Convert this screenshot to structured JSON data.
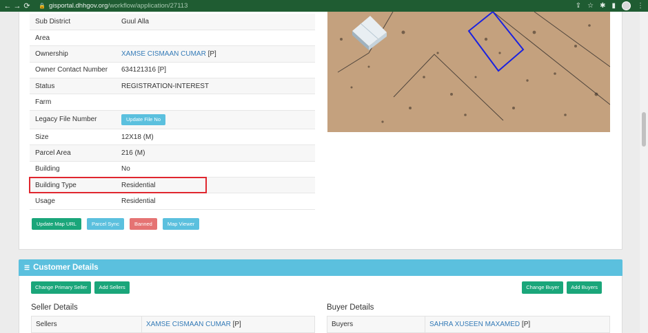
{
  "browser": {
    "url_host": "gisportal.dhhgov.org",
    "url_path": "/workflow/application/27113"
  },
  "parcel_info": {
    "rows": [
      {
        "label": "Sub District",
        "value": "Guul Alla"
      },
      {
        "label": "Area",
        "value": ""
      },
      {
        "label": "Ownership",
        "value": "XAMSE CISMAAN CUMAR",
        "value_suffix": " [P]"
      },
      {
        "label": "Owner Contact Number",
        "value": "634121316 [P]"
      },
      {
        "label": "Status",
        "value": "REGISTRATION-INTEREST"
      },
      {
        "label": "Farm",
        "value": ""
      },
      {
        "label": "Legacy File Number",
        "button": "Update File No"
      },
      {
        "label": "Size",
        "value": "12X18 (M)"
      },
      {
        "label": "Parcel Area",
        "value": "216 (M)"
      },
      {
        "label": "Building",
        "value": "No"
      },
      {
        "label": "Building Type",
        "value": "Residential"
      },
      {
        "label": "Usage",
        "value": "Residential"
      }
    ]
  },
  "actions": {
    "update_map_url": "Update Map URL",
    "parcel_sync": "Parcel Sync",
    "banned": "Banned",
    "map_viewer": "Map Viewer"
  },
  "customer": {
    "header": "Customer Details",
    "change_primary_seller": "Change Primary Seller",
    "add_sellers": "Add Sellers",
    "change_buyer": "Change Buyer",
    "add_buyers": "Add Buyers",
    "seller_title": "Seller Details",
    "buyer_title": "Buyer Details",
    "sellers_label": "Sellers",
    "seller_name": "XAMSE CISMAAN CUMAR",
    "seller_suffix": " [P]",
    "buyers_label": "Buyers",
    "buyer_name": "SAHRA XUSEEN MAXAMED",
    "buyer_suffix": " [P]"
  },
  "colors": {
    "chrome": "#1f5c32",
    "info": "#5bc0de",
    "success": "#1aa67a",
    "danger": "#e57373",
    "link": "#337ab7",
    "highlight": "#e0262e",
    "parcel_outline": "#1a22e0"
  }
}
